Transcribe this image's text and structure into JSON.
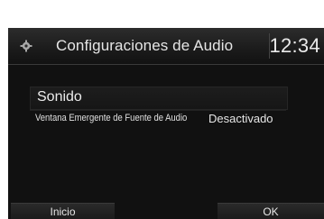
{
  "header": {
    "title": "Configuraciones de Audio",
    "clock": "12:34",
    "icon": "gear-icon"
  },
  "section": {
    "title": "Sonido"
  },
  "settings": [
    {
      "label": "Ventana Emergente de Fuente de Audio",
      "value": "Desactivado"
    }
  ],
  "footer": {
    "left_button": "Inicio",
    "right_button": "OK"
  },
  "colors": {
    "background": "#111111",
    "text": "#e6e6e6",
    "bezel": "#ffffff"
  }
}
